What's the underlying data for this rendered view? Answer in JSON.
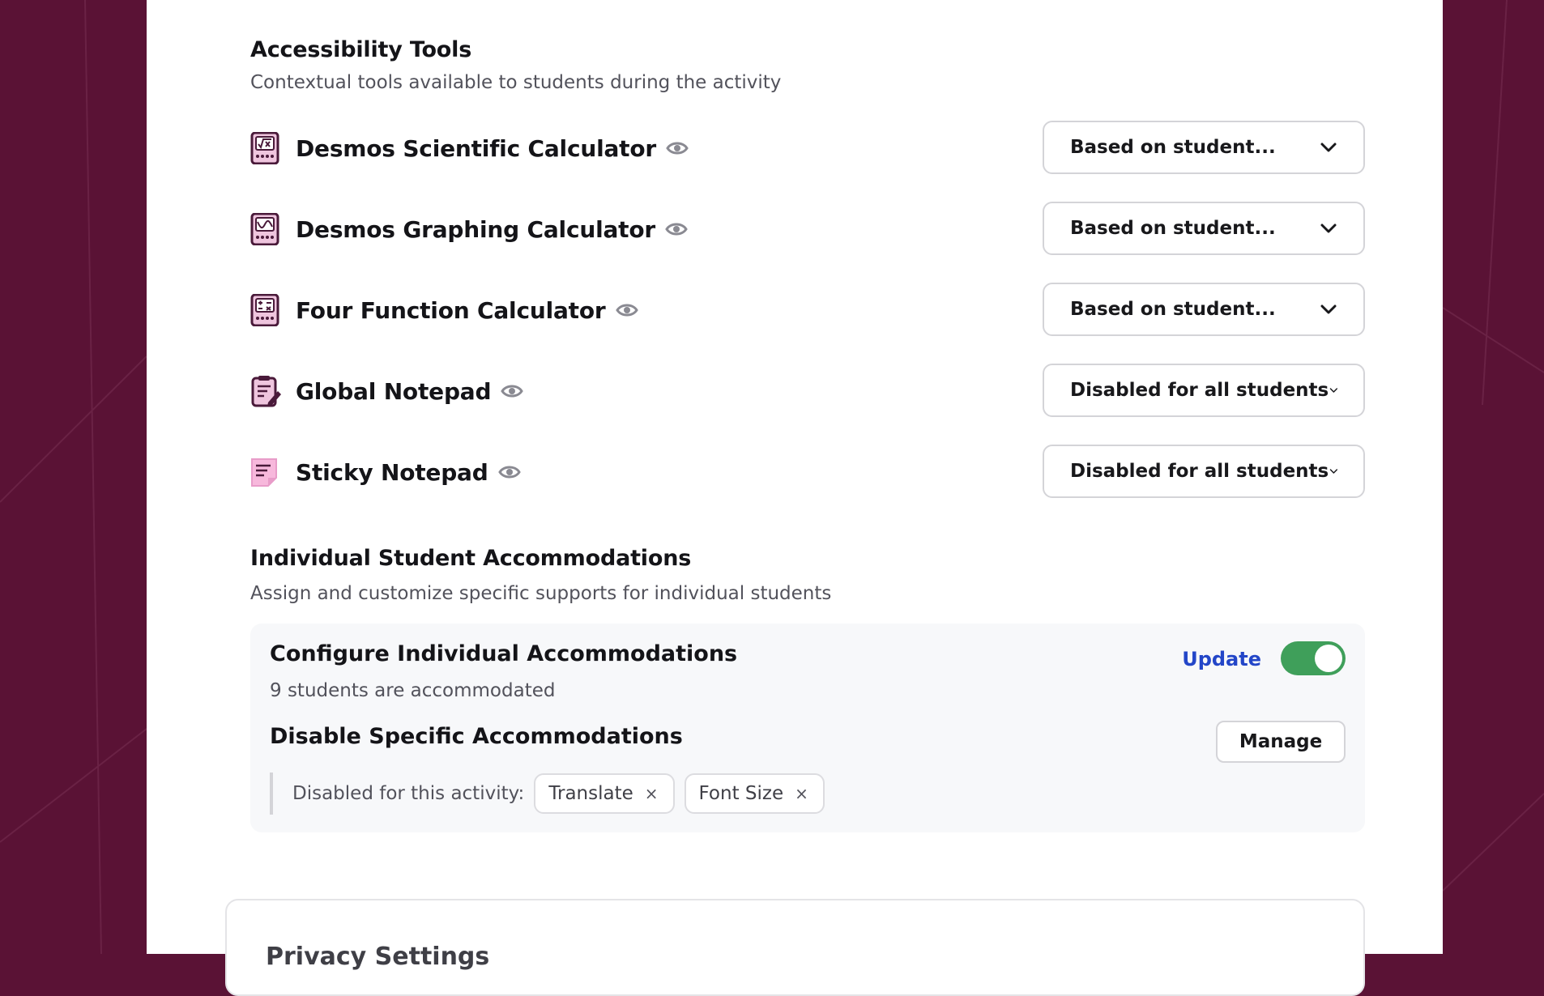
{
  "accessibility": {
    "title": "Accessibility Tools",
    "description": "Contextual tools available to students during the activity",
    "tools": [
      {
        "name": "Desmos Scientific Calculator",
        "icon": "scientific-calculator-icon",
        "setting": "Based on student..."
      },
      {
        "name": "Desmos Graphing Calculator",
        "icon": "graphing-calculator-icon",
        "setting": "Based on student..."
      },
      {
        "name": "Four Function Calculator",
        "icon": "four-function-calculator-icon",
        "setting": "Based on student..."
      },
      {
        "name": "Global Notepad",
        "icon": "global-notepad-icon",
        "setting": "Disabled for all students"
      },
      {
        "name": "Sticky Notepad",
        "icon": "sticky-notepad-icon",
        "setting": "Disabled for all students"
      }
    ]
  },
  "individual": {
    "title": "Individual Student Accommodations",
    "description": "Assign and customize specific supports for individual students",
    "configure_title": "Configure Individual Accommodations",
    "configure_sub": "9 students are accommodated",
    "update_label": "Update",
    "toggle_on": true,
    "disable_title": "Disable Specific Accommodations",
    "manage_label": "Manage",
    "disabled_label": "Disabled for this activity:",
    "chips": [
      "Translate",
      "Font Size"
    ],
    "chip_remove": "×"
  },
  "privacy": {
    "title": "Privacy Settings"
  },
  "colors": {
    "background": "#5a1235",
    "toggle_on": "#3f9f5a",
    "link": "#2346c8",
    "icon_purple": "#4a1a3a",
    "icon_pink": "#e89cc9"
  }
}
